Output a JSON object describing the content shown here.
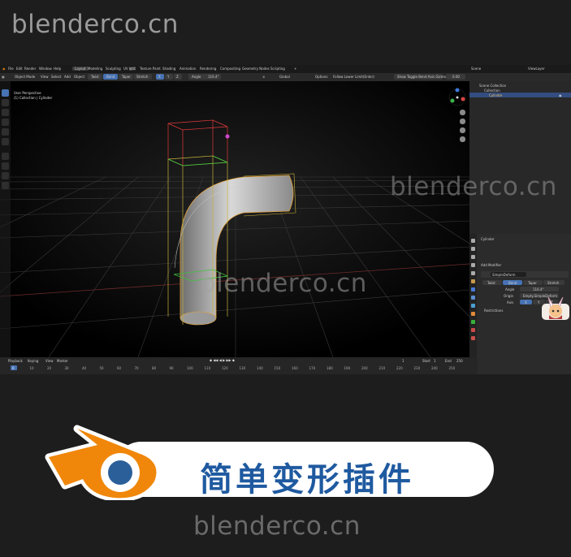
{
  "watermark": {
    "top": "blenderco.cn",
    "middle_right": "blenderco.cn",
    "middle": "blenderco.cn",
    "bottom": "blenderco.cn"
  },
  "menubar": {
    "menus": [
      "File",
      "Edit",
      "Render",
      "Window",
      "Help"
    ],
    "workspaces": [
      "Layout",
      "Modeling",
      "Sculpting",
      "UV 编辑",
      "Texture Paint",
      "Shading",
      "Animation",
      "Rendering",
      "Compositing",
      "Geometry Nodes",
      "Scripting"
    ],
    "scene": "Scene",
    "view_layer": "ViewLayer"
  },
  "toolrow": {
    "mode": "Object Mode",
    "view": "View",
    "select": "Select",
    "add": "Add",
    "object": "Object",
    "deform_modes": [
      "Twist",
      "Bend",
      "Taper",
      "Stretch"
    ],
    "axis_buttons": [
      "X",
      "Y",
      "Z"
    ],
    "angle_label": "Angle",
    "angle_value": "116.4°",
    "transform": "Global",
    "options": "Options",
    "follow": "Follow Lower Limit(Enter)",
    "show_toggle": "Show Toggle Bend Axis Gizmo",
    "show_value": "0.00"
  },
  "viewport": {
    "perspective": "User Perspective",
    "collection": "(1) Collection | Cylinder"
  },
  "outliner": {
    "scene_collection": "Scene Collection",
    "collection": "Collection",
    "object": "Cylinder"
  },
  "properties": {
    "header": "Cylinder",
    "modifier_panel": "Add Modifier",
    "modifier_name": "SimpleDeform",
    "modes": [
      "Twist",
      "Bend",
      "Taper",
      "Stretch"
    ],
    "angle_label": "Angle",
    "angle_value": "116.4°",
    "origin_label": "Origin",
    "origin_value": "Empty.SimpleDeform",
    "axis_label": "Axis",
    "axes": [
      "X",
      "Y",
      "Z"
    ],
    "restrictions": "Restrictions"
  },
  "timeline": {
    "playback": "Playback",
    "keying": "Keying",
    "view": "View",
    "marker": "Marker",
    "current_frame": "1",
    "start_label": "Start",
    "start_value": "1",
    "end_label": "End",
    "end_value": "250",
    "ticks": [
      "0",
      "10",
      "20",
      "30",
      "40",
      "50",
      "60",
      "70",
      "80",
      "90",
      "100",
      "110",
      "120",
      "130",
      "140",
      "150",
      "160",
      "170",
      "180",
      "190",
      "200",
      "210",
      "220",
      "230",
      "240",
      "250"
    ]
  },
  "banner": {
    "title": "简单变形插件"
  },
  "colors": {
    "accent": "#4772b3",
    "banner_text": "#1f5aa0",
    "logo_orange": "#f0870a",
    "logo_blue": "#2b5f9a"
  }
}
